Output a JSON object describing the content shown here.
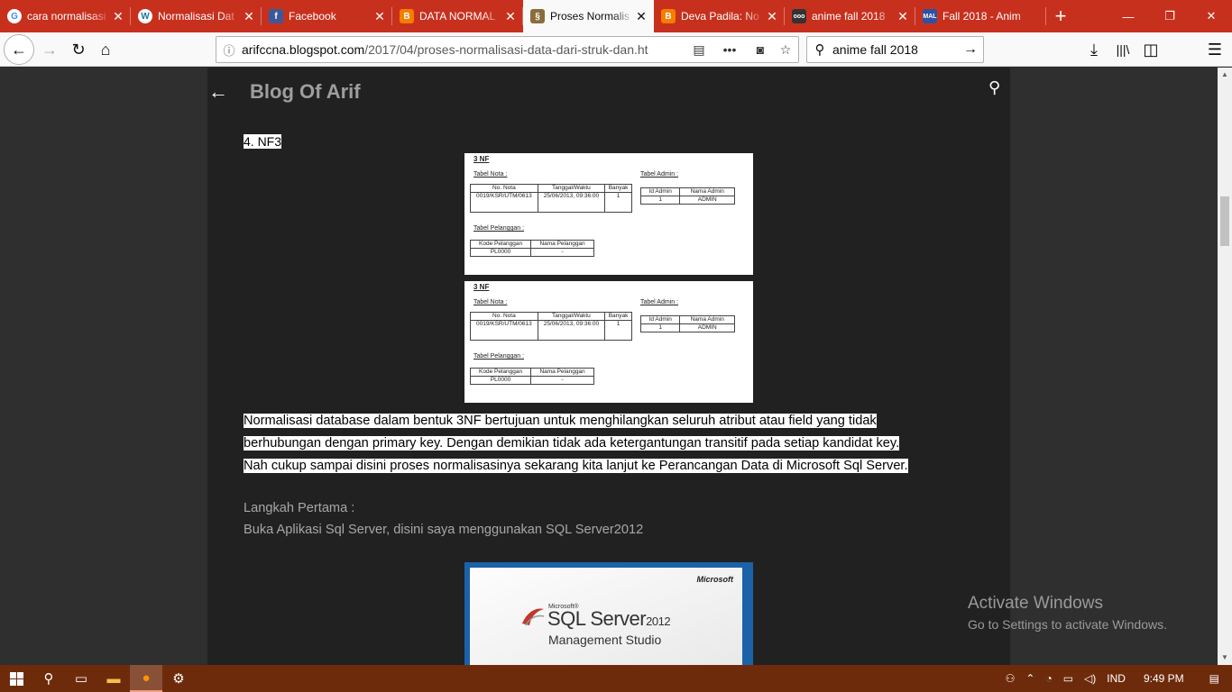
{
  "browser": {
    "tabs": [
      {
        "title": "cara normalisasi",
        "icon": "google-icon",
        "active": false
      },
      {
        "title": "Normalisasi Dat",
        "icon": "wordpress-icon",
        "active": false
      },
      {
        "title": "Facebook",
        "icon": "facebook-icon",
        "active": false
      },
      {
        "title": "DATA NORMAL",
        "icon": "blogger-icon",
        "active": false
      },
      {
        "title": "Proses Normalis",
        "icon": "stamp-icon",
        "active": true
      },
      {
        "title": "Deva Padila: No",
        "icon": "blogger-icon",
        "active": false
      },
      {
        "title": "anime fall 2018",
        "icon": "media-icon",
        "active": false
      },
      {
        "title": "Fall 2018 - Anim",
        "icon": "mal-icon",
        "active": false
      }
    ],
    "url_host": "arifccna.blogspot.com",
    "url_path": "/2017/04/proses-normalisasi-data-dari-struk-dan.ht",
    "search_value": "anime fall 2018"
  },
  "blog": {
    "title": "Blog Of Arif",
    "nf3_heading": "4. NF3",
    "figure": {
      "title": "3 NF",
      "tabel_nota_label": "Tabel Nota :",
      "tabel_admin_label": "Tabel Admin :",
      "tabel_pelanggan_label": "Tabel Pelanggan :",
      "nota_headers": [
        "No. Nota",
        "Tanggal/Waktu",
        "Banyak"
      ],
      "nota_row": [
        "0019/KSR/UTM/0613",
        "25/06/2013, 09:36:00",
        "1"
      ],
      "admin_headers": [
        "Id Admin",
        "Nama Admin"
      ],
      "admin_row": [
        "1",
        "ADMIN"
      ],
      "pelanggan_headers": [
        "Kode Pelanggan",
        "Nama Pelanggan"
      ],
      "pelanggan_row": [
        "PL0000",
        "-"
      ]
    },
    "paragraph_lines": [
      "Normalisasi database dalam bentuk 3NF bertujuan untuk menghilangkan seluruh atribut atau field yang tidak",
      "berhubungan dengan primary key. Dengan demikian tidak ada ketergantungan transitif pada setiap kandidat key.",
      "Nah cukup sampai disini proses normalisasinya sekarang kita lanjut ke Perancangan Data di Microsoft Sql Server."
    ],
    "step_title": "Langkah Pertama :",
    "step_text": "Buka Aplikasi Sql Server, disini saya menggunakan SQL Server2012",
    "splash": {
      "brand": "Microsoft",
      "ms_small": "Microsoft®",
      "product": "SQL Server",
      "version": "2012",
      "subtitle": "Management Studio"
    }
  },
  "watermark": {
    "line1": "Activate Windows",
    "line2": "Go to Settings to activate Windows."
  },
  "taskbar": {
    "language": "IND",
    "time": "9:49 PM"
  }
}
